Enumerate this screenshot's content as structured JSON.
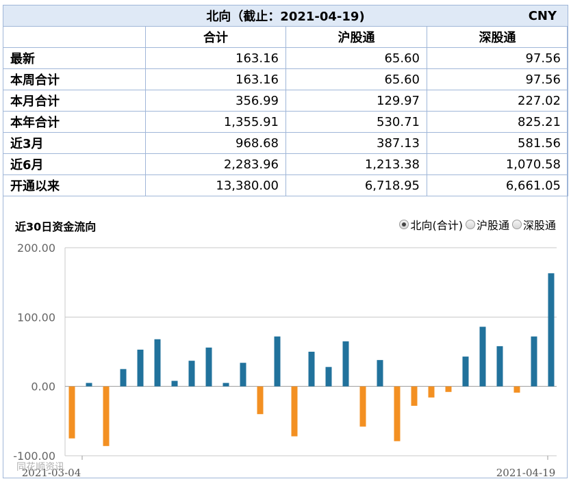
{
  "header": {
    "title": "北向（截止：2021-04-19)",
    "currency": "CNY"
  },
  "columns": [
    "合计",
    "沪股通",
    "深股通"
  ],
  "rows": [
    {
      "label": "最新",
      "values": [
        "163.16",
        "65.60",
        "97.56"
      ]
    },
    {
      "label": "本周合计",
      "values": [
        "163.16",
        "65.60",
        "97.56"
      ]
    },
    {
      "label": "本月合计",
      "values": [
        "356.99",
        "129.97",
        "227.02"
      ]
    },
    {
      "label": "本年合计",
      "values": [
        "1,355.91",
        "530.71",
        "825.21"
      ]
    },
    {
      "label": "近3月",
      "values": [
        "968.68",
        "387.13",
        "581.56"
      ]
    },
    {
      "label": "近6月",
      "values": [
        "2,283.96",
        "1,213.38",
        "1,070.58"
      ]
    },
    {
      "label": "开通以来",
      "values": [
        "13,380.00",
        "6,718.95",
        "6,661.05"
      ]
    }
  ],
  "chart": {
    "title": "近30日资金流向",
    "options": [
      {
        "label": "北向(合计)",
        "checked": true
      },
      {
        "label": "沪股通",
        "checked": false
      },
      {
        "label": "深股通",
        "checked": false
      }
    ],
    "watermark": "同花顺资讯"
  },
  "colors": {
    "positive": "#21729c",
    "negative": "#f39022",
    "grid": "#c8c8c8",
    "header_bg": "#dfe9f6",
    "border": "#9fb6d8"
  },
  "chart_data": {
    "type": "bar",
    "title": "近30日资金流向",
    "ylim": [
      -100,
      200
    ],
    "yticks": [
      "200.00",
      "100.00",
      "0.00",
      "-100.00"
    ],
    "ytick_values": [
      200,
      100,
      0,
      -100
    ],
    "xlabels": [
      "2021-03-04",
      "2021-04-19"
    ],
    "values": [
      -75,
      5,
      -86,
      25,
      53,
      68,
      8,
      37,
      56,
      5,
      34,
      -40,
      72,
      -72,
      50,
      28,
      65,
      -58,
      38,
      -79,
      -28,
      -16,
      -8,
      43,
      86,
      58,
      -9,
      72,
      163.16
    ]
  }
}
